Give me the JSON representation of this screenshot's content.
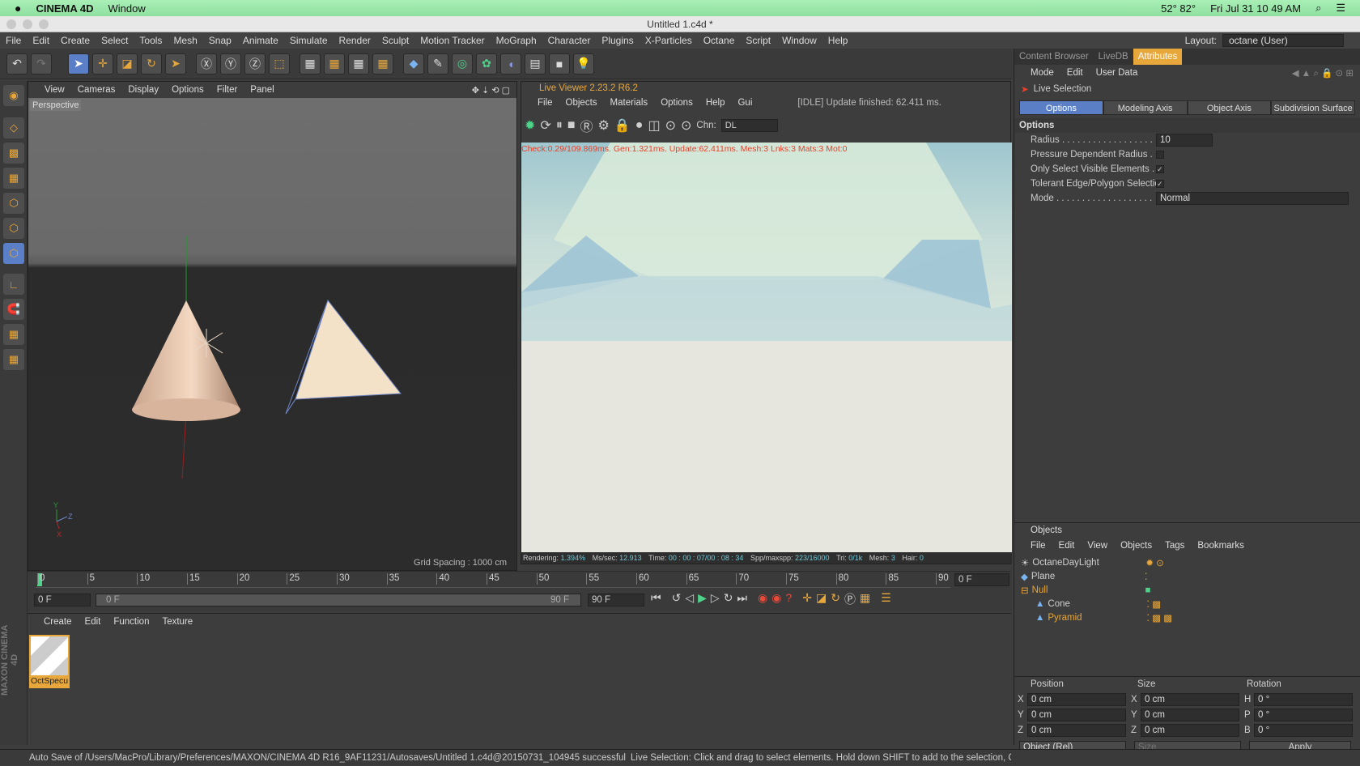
{
  "menubar": {
    "app": "CINEMA 4D",
    "window": "Window",
    "temp": "52° 82°",
    "datetime": "Fri Jul 31  10 49 AM"
  },
  "titlebar": {
    "title": "Untitled 1.c4d *"
  },
  "mainmenu": [
    "File",
    "Edit",
    "Create",
    "Select",
    "Tools",
    "Mesh",
    "Snap",
    "Animate",
    "Simulate",
    "Render",
    "Sculpt",
    "Motion Tracker",
    "MoGraph",
    "Character",
    "Plugins",
    "X-Particles",
    "Octane",
    "Script",
    "Window",
    "Help"
  ],
  "layout": {
    "label": "Layout:",
    "value": "octane (User)"
  },
  "viewport": {
    "menu": [
      "View",
      "Cameras",
      "Display",
      "Options",
      "Filter",
      "Panel"
    ],
    "name": "Perspective",
    "grid": "Grid Spacing : 1000 cm"
  },
  "liveviewer": {
    "title": "Live Viewer 2.23.2 R6.2",
    "menu": [
      "File",
      "Objects",
      "Materials",
      "Options",
      "Help",
      "Gui"
    ],
    "status": "[IDLE] Update finished: 62.411 ms.",
    "chn_label": "Chn:",
    "chn_value": "DL",
    "stats": "Check:0.29/109.869ms. Gen:1.321ms. Update:62.411ms. Mesh:3 Lnks:3 Mats:3 Mot:0",
    "footer": {
      "rendering_label": "Rendering:",
      "rendering": "1.394%",
      "mssec_label": "Ms/sec:",
      "mssec": "12.913",
      "time_label": "Time:",
      "time": "00 : 00 : 07/00 : 08 : 34",
      "spp_label": "Spp/maxspp:",
      "spp": "223/16000",
      "tri_label": "Tri:",
      "tri": "0/1k",
      "mesh_label": "Mesh:",
      "mesh": "3",
      "hair_label": "Hair:",
      "hair": "0"
    }
  },
  "timeline": {
    "ticks": [
      "0",
      "5",
      "10",
      "15",
      "20",
      "25",
      "30",
      "35",
      "40",
      "45",
      "50",
      "55",
      "60",
      "65",
      "70",
      "75",
      "80",
      "85",
      "90"
    ],
    "frame_right": "0 F",
    "start": "0 F",
    "range_left": "0 F",
    "range_right": "90 F",
    "end": "90 F"
  },
  "material": {
    "menu": [
      "Create",
      "Edit",
      "Function",
      "Texture"
    ],
    "item": "OctSpecu"
  },
  "attributes": {
    "tabs": [
      "Content Browser",
      "LiveDB",
      "Attributes"
    ],
    "menu": [
      "Mode",
      "Edit",
      "User Data"
    ],
    "tool": "Live Selection",
    "subtabs": [
      "Options",
      "Modeling Axis",
      "Object Axis",
      "Subdivision Surface"
    ],
    "section": "Options",
    "rows": [
      {
        "label": "Radius . . . . . . . . . . . . . . . . . .",
        "value": "10"
      },
      {
        "label": "Pressure Dependent Radius . . . ."
      },
      {
        "label": "Only Select Visible Elements . . . ."
      },
      {
        "label": "Tolerant Edge/Polygon Selection"
      },
      {
        "label": "Mode . . . . . . . . . . . . . . . . . . .",
        "value": "Normal"
      }
    ]
  },
  "objects": {
    "title": "Objects",
    "menu": [
      "File",
      "Edit",
      "View",
      "Objects",
      "Tags",
      "Bookmarks"
    ],
    "items": [
      "OctaneDayLight",
      "Plane",
      "Null",
      "Cone",
      "Pyramid"
    ]
  },
  "coords": {
    "headers": [
      "Position",
      "Size",
      "Rotation"
    ],
    "rows": [
      [
        "X",
        "0 cm",
        "X",
        "0 cm",
        "H",
        "0 °"
      ],
      [
        "Y",
        "0 cm",
        "Y",
        "0 cm",
        "P",
        "0 °"
      ],
      [
        "Z",
        "0 cm",
        "Z",
        "0 cm",
        "B",
        "0 °"
      ]
    ],
    "mode": "Object (Rel)",
    "size": "Size",
    "apply": "Apply"
  },
  "status": {
    "left": "Auto Save of /Users/MacPro/Library/Preferences/MAXON/CINEMA 4D R16_9AF11231/Autosaves/Untitled 1.c4d@20150731_104945 successful",
    "right": "Live Selection: Click and drag to select elements. Hold down SHIFT to add to the selection, CTR"
  },
  "brand": "MAXON CINEMA 4D"
}
